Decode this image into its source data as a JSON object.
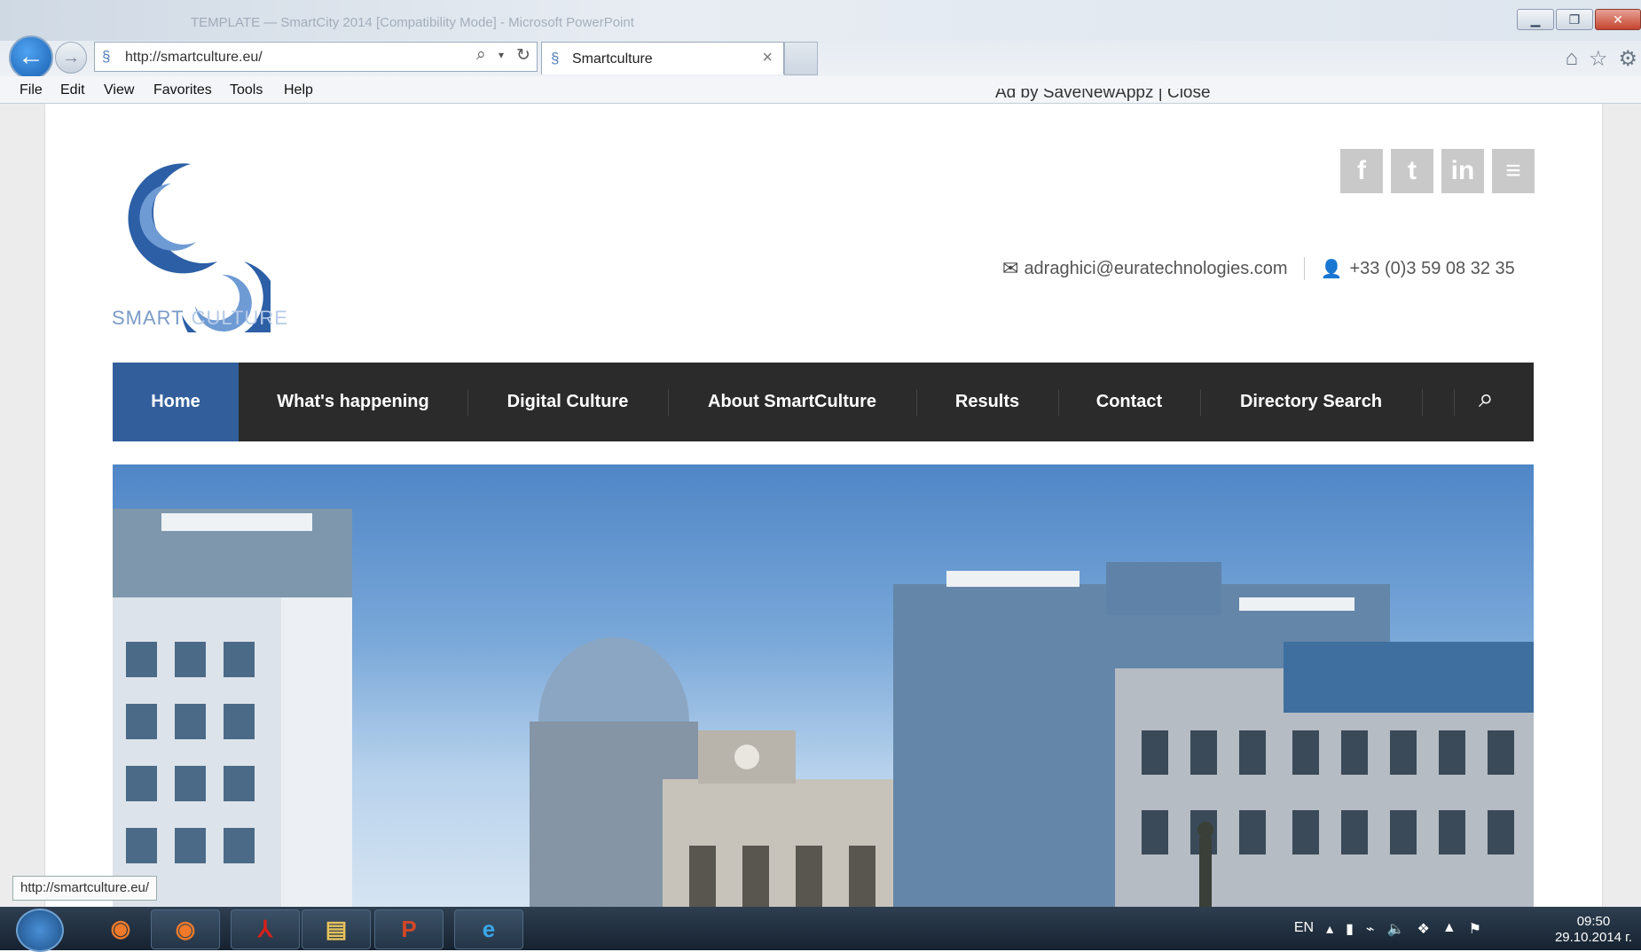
{
  "browser": {
    "window_title": "TEMPLATE — SmartCity 2014 [Compatibility Mode] - Microsoft PowerPoint",
    "address_url": "http://smartculture.eu/",
    "tab_title": "Smartculture",
    "tab_close": "×",
    "menu": [
      "File",
      "Edit",
      "View",
      "Favorites",
      "Tools",
      "Help"
    ],
    "status_url": "http://smartculture.eu/"
  },
  "page": {
    "ad_text": "Ad by SaveNewAppz | Close",
    "logo": {
      "word1": "SMART",
      "word2": "CULTURE"
    },
    "social": {
      "facebook": "f",
      "twitter": "t",
      "linkedin": "in",
      "news": "≡"
    },
    "contact": {
      "email": "adraghici@euratechnologies.com",
      "phone": "+33 (0)3 59 08 32 35"
    },
    "nav": [
      {
        "label": "Home",
        "active": true
      },
      {
        "label": "What's happening"
      },
      {
        "label": "Digital Culture"
      },
      {
        "label": "About SmartCulture"
      },
      {
        "label": "Results"
      },
      {
        "label": "Contact"
      },
      {
        "label": "Directory Search"
      }
    ],
    "accent_color": "#325f9c",
    "nav_bg": "#2b2b2b"
  },
  "taskbar": {
    "apps": [
      "firefox",
      "firefox",
      "acrobat",
      "explorer",
      "powerpoint",
      "internet-explorer"
    ],
    "language": "EN",
    "time": "09:50",
    "date": "29.10.2014 г."
  }
}
